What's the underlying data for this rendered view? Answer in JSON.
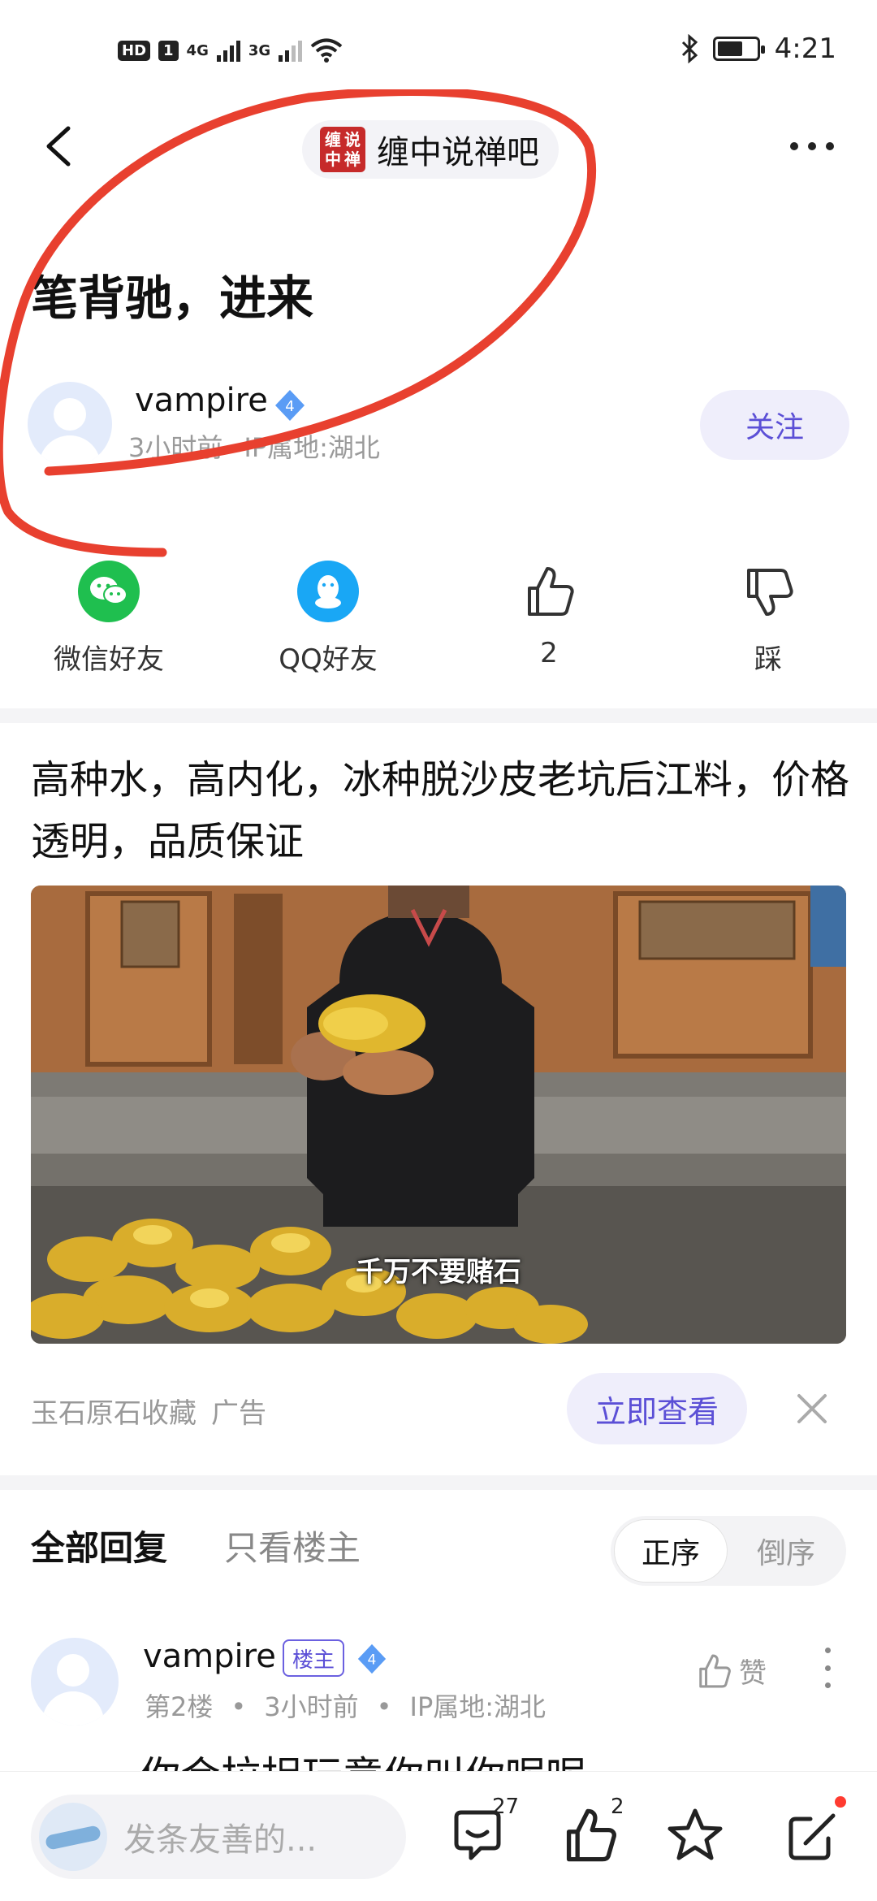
{
  "status_bar": {
    "hd": "HD",
    "sim": "1",
    "net1": "4G",
    "net2": "3G",
    "time": "4:21",
    "battery_level": 0.65
  },
  "nav": {
    "forum_logo_chars": [
      "缠",
      "说",
      "中",
      "禅"
    ],
    "forum_name": "缠中说禅吧"
  },
  "post": {
    "title": "笔背驰，进来",
    "author": {
      "name": "vampire",
      "level": "4",
      "time": "3小时前",
      "ip": "IP属地:湖北"
    },
    "follow_label": "关注"
  },
  "share": {
    "wechat_label": "微信好友",
    "qq_label": "QQ好友",
    "like_count": "2",
    "dislike_label": "踩"
  },
  "ad": {
    "title": "高种水，高内化，冰种脱沙皮老坑后江料，价格透明，品质保证",
    "caption": "千万不要赌石",
    "source": "玉石原石收藏",
    "tag": "广告",
    "cta": "立即查看"
  },
  "replies": {
    "tab_all": "全部回复",
    "tab_op": "只看楼主",
    "sort_asc": "正序",
    "sort_desc": "倒序",
    "first": {
      "name": "vampire",
      "op_badge": "楼主",
      "level": "4",
      "floor": "第2楼",
      "time": "3小时前",
      "ip": "IP属地:湖北",
      "like_label": "赞",
      "text_peek": "你会拉拐玩意你叫你呢呢"
    }
  },
  "bottom_bar": {
    "placeholder": "发条友善的...",
    "comment_count": "27",
    "like_count": "2"
  },
  "colors": {
    "accent": "#5b4fd6",
    "annotation": "#e8402f",
    "wechat": "#1fbf4f",
    "qq": "#19a7f5"
  }
}
